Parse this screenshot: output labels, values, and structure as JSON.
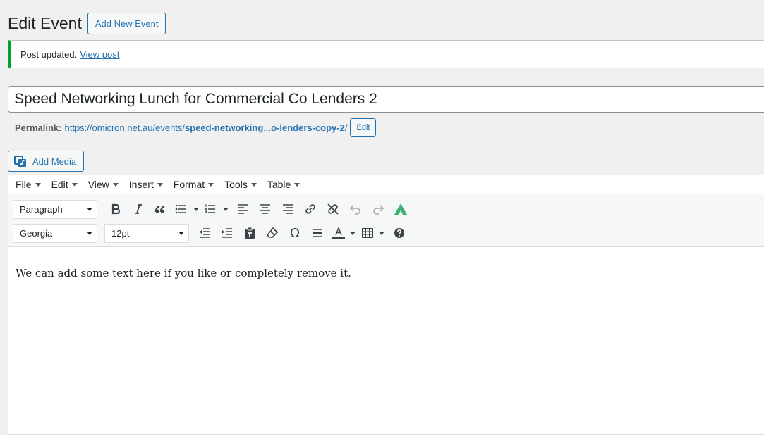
{
  "header": {
    "title": "Edit Event",
    "add_new_label": "Add New Event"
  },
  "notice": {
    "text": "Post updated.",
    "link_text": "View post",
    "color": "#00a32a"
  },
  "post": {
    "title": "Speed Networking Lunch for Commercial Co Lenders 2",
    "permalink_label": "Permalink:",
    "permalink_base": "https://omicron.net.au/events/",
    "permalink_slug": "speed-networking...o-lenders-copy-2",
    "permalink_trailing": "/",
    "edit_label": "Edit"
  },
  "media": {
    "add_media_label": "Add Media"
  },
  "menubar": {
    "items": [
      {
        "label": "File"
      },
      {
        "label": "Edit"
      },
      {
        "label": "View"
      },
      {
        "label": "Insert"
      },
      {
        "label": "Format"
      },
      {
        "label": "Tools"
      },
      {
        "label": "Table"
      }
    ]
  },
  "toolbar": {
    "block_format": "Paragraph",
    "font_family": "Georgia",
    "font_size": "12pt",
    "row1_icons": [
      "bold-icon",
      "italic-icon",
      "blockquote-icon",
      "bullet-list-icon",
      "numbered-list-icon",
      "align-left-icon",
      "align-center-icon",
      "align-right-icon",
      "link-icon",
      "unlink-icon",
      "undo-icon",
      "redo-icon",
      "plugin-logo-icon"
    ],
    "row2_icons": [
      "outdent-icon",
      "indent-icon",
      "paste-text-icon",
      "clear-formatting-icon",
      "special-character-icon",
      "horizontal-line-icon",
      "text-color-icon",
      "table-icon",
      "help-icon"
    ],
    "accent_color": "#2271b1",
    "plugin_color": "#3db271"
  },
  "content": {
    "text": "We can add some text here if you like or completely remove it."
  }
}
